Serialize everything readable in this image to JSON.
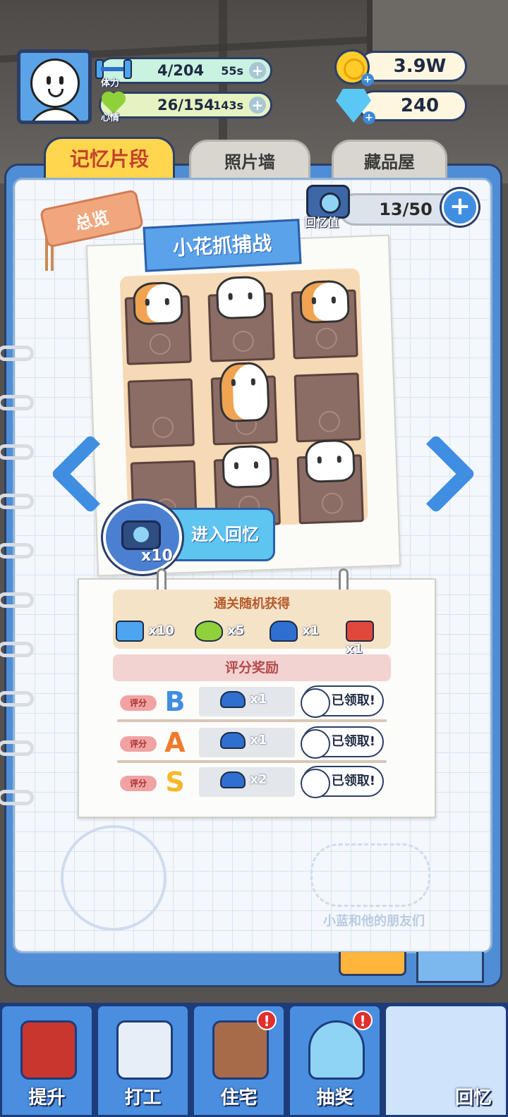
{
  "hud": {
    "stamina": {
      "label": "体力",
      "value": "4/204",
      "timer": "55s"
    },
    "mood": {
      "label": "心情",
      "value": "26/154",
      "timer": "143s"
    },
    "coins": "3.9W",
    "gems": "240"
  },
  "tabs": [
    {
      "label": "记忆片段",
      "active": true
    },
    {
      "label": "照片墙",
      "active": false
    },
    {
      "label": "藏品屋",
      "active": false
    }
  ],
  "overview_tag": "总览",
  "memory": {
    "label": "回忆值",
    "value": "13/50"
  },
  "episode": {
    "title": "小花抓捕战"
  },
  "enter": {
    "label": "进入回忆",
    "cost": "x10"
  },
  "rewards": {
    "random_title": "通关随机获得",
    "items": [
      {
        "icon": "dumbbell-icon",
        "qty": "x10"
      },
      {
        "icon": "heart-icon",
        "qty": "x5"
      },
      {
        "icon": "car-icon",
        "qty": "x1"
      },
      {
        "icon": "brick-icon",
        "qty": "x1"
      }
    ],
    "score_title": "评分奖励",
    "score_tag": "评分",
    "rows": [
      {
        "grade": "B",
        "grade_color": "#3f8ee2",
        "qty": "x1",
        "status": "已领取!"
      },
      {
        "grade": "A",
        "grade_color": "#f07a2c",
        "qty": "x1",
        "status": "已领取!"
      },
      {
        "grade": "S",
        "grade_color": "#f5b82a",
        "qty": "x2",
        "status": "已领取!"
      }
    ]
  },
  "deco_text": "小蓝和他的朋友们",
  "nav": [
    {
      "label": "提升",
      "alert": false
    },
    {
      "label": "打工",
      "alert": false
    },
    {
      "label": "住宅",
      "alert": true
    },
    {
      "label": "抽奖",
      "alert": true
    },
    {
      "label": "回忆",
      "alert": false,
      "active": true
    }
  ],
  "colors": {
    "accent": "#3f8ee2",
    "tab_active": "#ffd64d",
    "alert": "#e0302c"
  }
}
